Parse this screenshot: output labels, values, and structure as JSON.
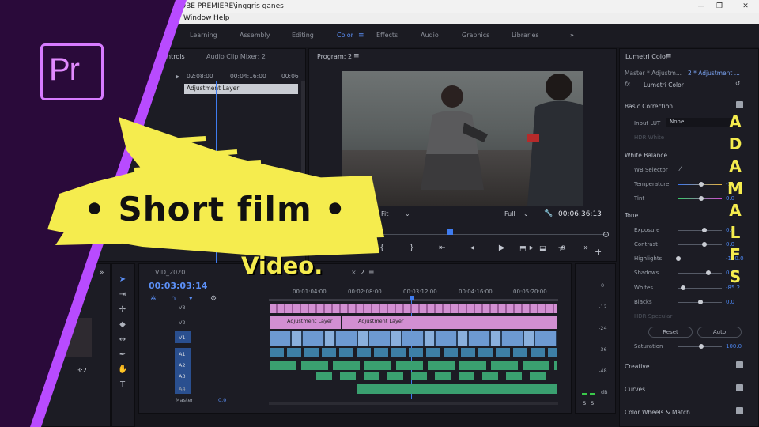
{
  "window": {
    "title": "OBE PREMIERE\\inggris ganes",
    "menus": [
      "Window",
      "Help"
    ]
  },
  "workspaces": {
    "items": [
      "Learning",
      "Assembly",
      "Editing",
      "Color",
      "Effects",
      "Audio",
      "Graphics",
      "Libraries"
    ],
    "active": "Color",
    "overflow": "»"
  },
  "source_panel": {
    "tabs": [
      "ntrols",
      "Audio Clip Mixer: 2"
    ],
    "timecodes": [
      "02:08:00",
      "00:04:16:00",
      "00:06"
    ],
    "clip_label": "Adjustment Layer"
  },
  "program_monitor": {
    "tab": "Program: 2",
    "fit": "Fit",
    "resolution": "Full",
    "timecode": "00:06:36:13"
  },
  "lumetri": {
    "tab": "Lumetri Color",
    "master": "Master * Adjustm...",
    "sequence": "2 * Adjustment ...",
    "fx_label": "Lumetri Color",
    "basic_correction": "Basic Correction",
    "input_lut_label": "Input LUT",
    "input_lut_value": "None",
    "hdr_white": "HDR White",
    "white_balance": "White Balance",
    "wb_selector": "WB Selector",
    "temperature": {
      "label": "Temperature",
      "value": "-1"
    },
    "tint": {
      "label": "Tint",
      "value": "0.0"
    },
    "tone": "Tone",
    "exposure": {
      "label": "Exposure",
      "value": "0.0"
    },
    "contrast": {
      "label": "Contrast",
      "value": "0.0"
    },
    "highlights": {
      "label": "Highlights",
      "value": "-100.0"
    },
    "shadows": {
      "label": "Shadows",
      "value": "0.0"
    },
    "whites": {
      "label": "Whites",
      "value": "-85.2"
    },
    "blacks": {
      "label": "Blacks",
      "value": "0.0"
    },
    "hdr_specular": "HDR Specular",
    "reset": "Reset",
    "auto": "Auto",
    "saturation": {
      "label": "Saturation",
      "value": "100.0"
    },
    "sections": [
      "Creative",
      "Curves",
      "Color Wheels & Match"
    ]
  },
  "timeline": {
    "project_tab": "VID_2020",
    "sequence_tab": "2",
    "timecode": "00:03:03:14",
    "ruler": [
      "00:01:04:00",
      "00:02:08:00",
      "00:03:12:00",
      "00:04:16:00",
      "00:05:20:00"
    ],
    "tracks": [
      "V3",
      "V2",
      "V1",
      "A1",
      "A2",
      "A3",
      "A4"
    ],
    "master_label": "Master",
    "master_value": "0.0",
    "adjustment_clips": [
      "Adjustment Layer",
      "Adjustment Layer"
    ],
    "meter_scale": [
      "0",
      "-12",
      "-24",
      "-36",
      "-48",
      "dB"
    ],
    "solo": [
      "S",
      "S"
    ]
  },
  "project_panel": {
    "duration": "3:21"
  },
  "overlay": {
    "logo_text": "Pr",
    "headline": "• Short  film •",
    "subline": "Video.",
    "vertical_brand": [
      "A",
      "D",
      "A",
      "M",
      "A",
      "L",
      "F",
      "S"
    ]
  },
  "colors": {
    "purple": "#2a0a3a",
    "accent_purple": "#b84bff",
    "yellow": "#f5ec4e",
    "blue_ui": "#4c86f0",
    "adjustment_clip": "#d08ad0",
    "video_clip": "#6a9ad0",
    "audio_clip": "#3aa070"
  }
}
